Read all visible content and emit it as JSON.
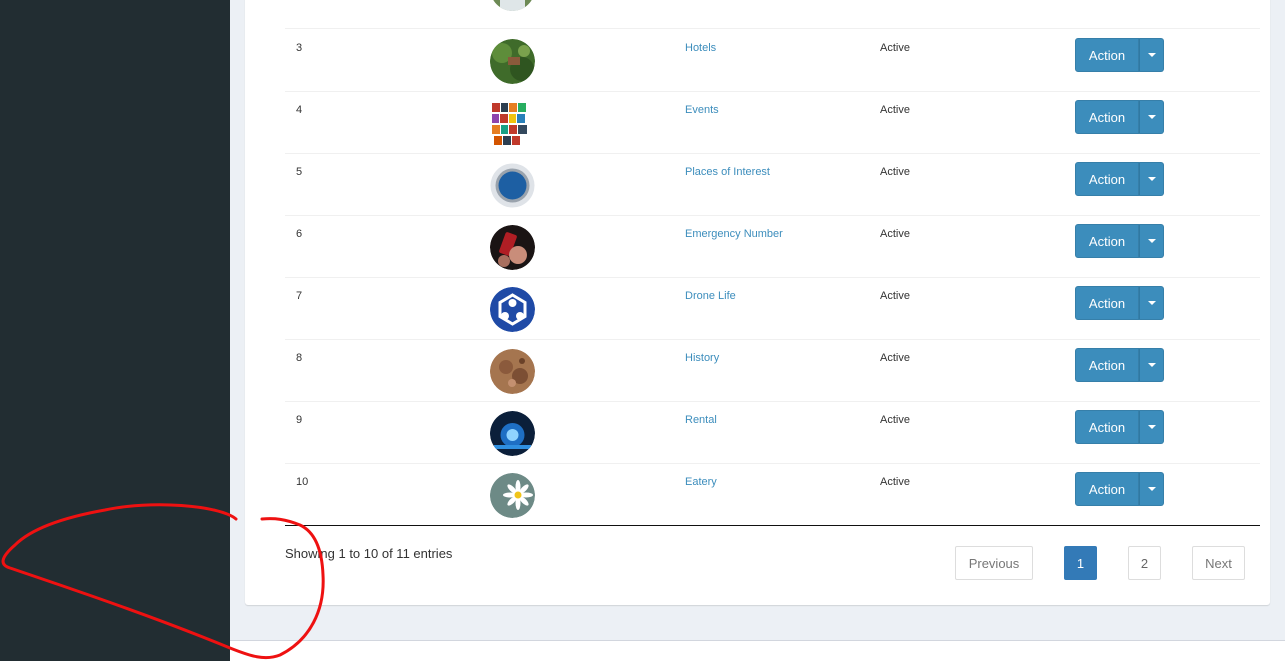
{
  "table": {
    "rows": [
      {
        "num": "3",
        "name": "Hotels",
        "status": "Active",
        "action": "Action",
        "image": "forest-photo"
      },
      {
        "num": "4",
        "name": "Events",
        "status": "Active",
        "action": "Action",
        "image": "world-creole-music-festival-logo"
      },
      {
        "num": "5",
        "name": "Places of Interest",
        "status": "Active",
        "action": "Action",
        "image": "demo-badge"
      },
      {
        "num": "6",
        "name": "Emergency Number",
        "status": "Active",
        "action": "Action",
        "image": "phone-photo"
      },
      {
        "num": "7",
        "name": "Drone Life",
        "status": "Active",
        "action": "Action",
        "image": "blue-hexagon-logo"
      },
      {
        "num": "8",
        "name": "History",
        "status": "Active",
        "action": "Action",
        "image": "sepia-map-photo"
      },
      {
        "num": "9",
        "name": "Rental",
        "status": "Active",
        "action": "Action",
        "image": "blue-light-photo"
      },
      {
        "num": "10",
        "name": "Eatery",
        "status": "Active",
        "action": "Action",
        "image": "daisy-photo"
      }
    ],
    "partial_row_action": ""
  },
  "footer": {
    "info": "Showing 1 to 10 of 11 entries",
    "pagination": {
      "previous": "Previous",
      "page1": "1",
      "page2": "2",
      "next": "Next"
    }
  },
  "colors": {
    "primary": "#3c8dbc",
    "sidebar": "#222d32",
    "annotation": "#ee1111"
  }
}
